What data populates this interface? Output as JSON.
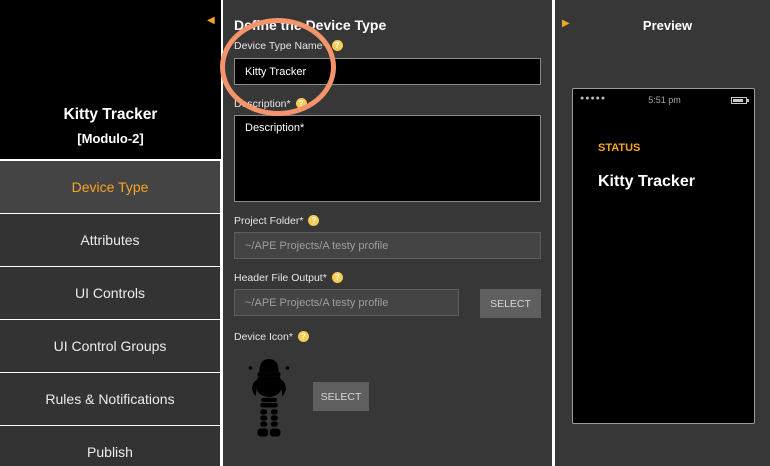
{
  "sidebar": {
    "profile": {
      "device_name": "Kitty Tracker",
      "device_model": "[Modulo-2]",
      "collapse_icon": "caret-left-icon",
      "image_icon": "robot-icon"
    },
    "items": [
      {
        "label": "Device Type",
        "active": true
      },
      {
        "label": "Attributes",
        "active": false
      },
      {
        "label": "UI Controls",
        "active": false
      },
      {
        "label": "UI Control Groups",
        "active": false
      },
      {
        "label": "Rules & Notifications",
        "active": false
      },
      {
        "label": "Publish",
        "active": false
      }
    ]
  },
  "form": {
    "title": "Define the Device Type",
    "device_type_name": {
      "label": "Device Type Name*",
      "value": "Kitty Tracker"
    },
    "description": {
      "label": "Description*",
      "placeholder": "Description*"
    },
    "project_folder": {
      "label": "Project Folder*",
      "value": "~/APE Projects/A testy profile"
    },
    "header_file_output": {
      "label": "Header File Output*",
      "value": "~/APE Projects/A testy profile",
      "button": "SELECT"
    },
    "device_icon": {
      "label": "Device Icon*",
      "button": "SELECT"
    },
    "help_icon": "question-mark-icon"
  },
  "preview": {
    "title": "Preview",
    "toggle_icon": "caret-right-icon",
    "phone": {
      "signal": "●●●●●",
      "time": "5:51 pm",
      "status_label": "STATUS",
      "device_name": "Kitty Tracker"
    }
  },
  "colors": {
    "accent": "#f5a623",
    "help_icon": "#f7cc55",
    "highlight_ring": "#f5936b",
    "panel_bg": "#373737",
    "nav_bg": "#333333"
  }
}
